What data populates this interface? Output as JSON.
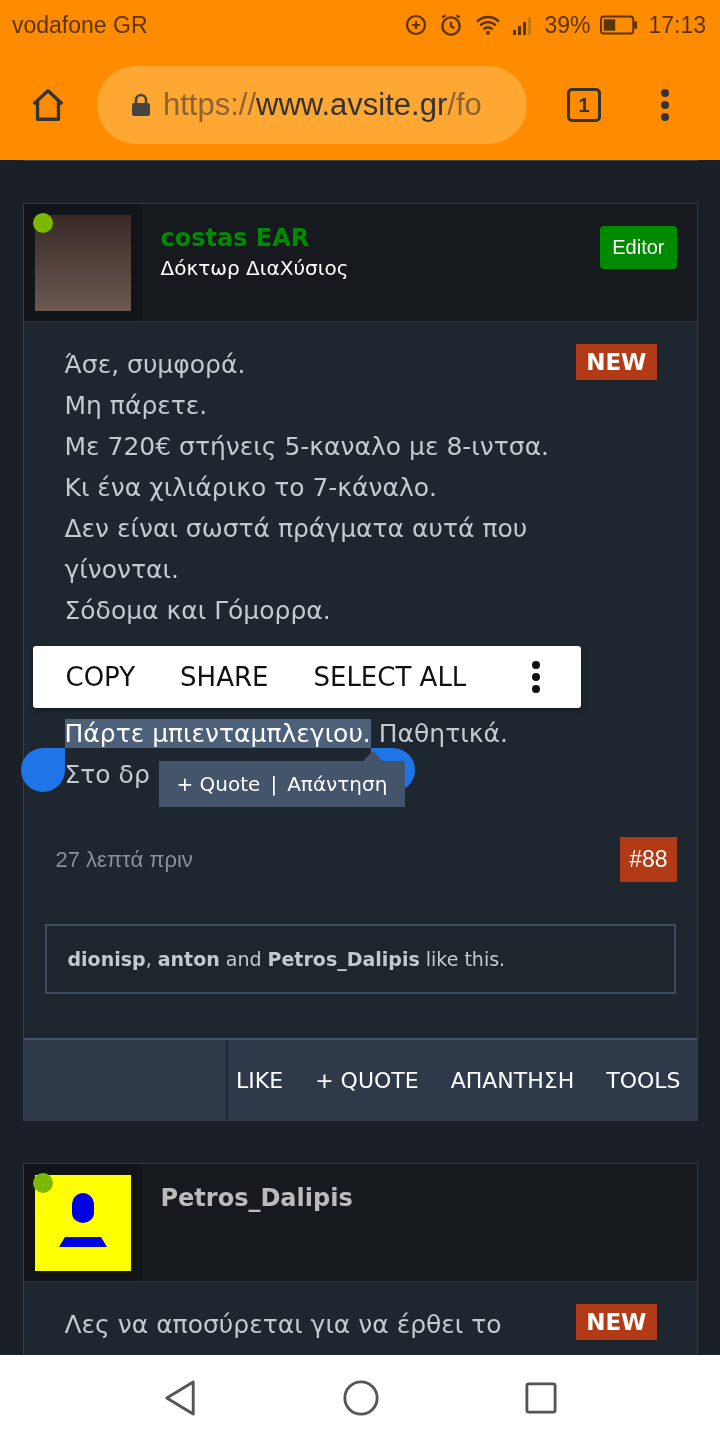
{
  "status_bar": {
    "carrier": "vodafone GR",
    "battery": "39%",
    "time": "17:13"
  },
  "browser": {
    "url_scheme": "https://",
    "url_host": "www.avsite.gr",
    "url_path": "/fo",
    "tab_count": "1"
  },
  "posts": [
    {
      "author": "costas EAR",
      "color": "#008a00",
      "online": true,
      "kind": "photo",
      "title": "Δόκτωρ ΔιαΧύσιος",
      "badge": "Editor",
      "new_badge": "NEW",
      "lines": [
        {
          "kind": "text",
          "segments": [
            {
              "text": "Άσε, συμφορά.",
              "selected": false
            }
          ]
        },
        {
          "kind": "text",
          "segments": [
            {
              "text": "Μη πάρετε.",
              "selected": false
            }
          ]
        },
        {
          "kind": "text",
          "segments": [
            {
              "text": "Με 720€ στήνεις 5-καναλο με 8-ιντσα.",
              "selected": false
            }
          ]
        },
        {
          "kind": "text",
          "segments": [
            {
              "text": "Κι ένα χιλιάρικο το 7-κάναλο.",
              "selected": false
            }
          ]
        },
        {
          "kind": "text",
          "segments": [
            {
              "text": "Δεν είναι σωστά πράγματα αυτά που",
              "selected": false
            }
          ]
        },
        {
          "kind": "text",
          "segments": [
            {
              "text": "γίνονται.",
              "selected": false
            }
          ]
        },
        {
          "kind": "text",
          "segments": [
            {
              "text": "Σόδομα και Γόμορρα.",
              "selected": false
            }
          ]
        },
        {
          "kind": "hidden"
        },
        {
          "kind": "hidden"
        },
        {
          "kind": "text",
          "segments": [
            {
              "text": "Πάρτε μπιενταμπλεγιου.",
              "selected": true
            },
            {
              "text": " Παθητικά.",
              "selected": false
            }
          ]
        },
        {
          "kind": "text",
          "segments": [
            {
              "text": "Στο δρ",
              "selected": false
            }
          ]
        }
      ],
      "time": "27 λεπτά πριν",
      "number": "#88",
      "likes": "**dionisp**, **anton** and **Petros_Dalipis** like this.",
      "actions": [
        "LIKE",
        "+ QUOTE",
        "ΑΠΑΝΤΗΣΗ",
        "TOOLS"
      ]
    },
    {
      "author": "Petros_Dalipis",
      "color": "#bbbbbb",
      "online": true,
      "kind": "default",
      "new_badge": "NEW",
      "lines": [
        {
          "kind": "text",
          "segments": [
            {
              "text": "Λες να αποσύρεται για να έρθει το",
              "selected": false
            }
          ]
        }
      ]
    }
  ],
  "selection_toolbar": {
    "items": [
      "COPY",
      "SHARE",
      "SELECT ALL"
    ]
  },
  "quote_popup": {
    "quote": "+ Quote",
    "separator": "|",
    "reply": "Απάντηση"
  }
}
